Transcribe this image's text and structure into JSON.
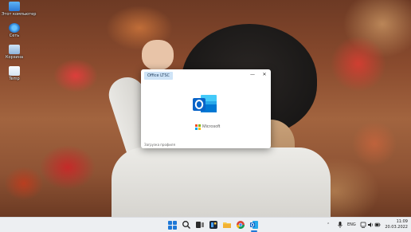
{
  "desktop": {
    "icons": [
      {
        "label": "Этот компьютер",
        "icon": "computer-icon"
      },
      {
        "label": "Сеть",
        "icon": "network-icon"
      },
      {
        "label": "Корзина",
        "icon": "recycle-bin-icon"
      },
      {
        "label": "Temp",
        "icon": "folder-icon"
      }
    ]
  },
  "splash": {
    "badge": "Office LTSC",
    "minimize_glyph": "—",
    "close_glyph": "✕",
    "app_icon": "outlook-icon",
    "brand": "Microsoft",
    "status": "Загрузка профиля"
  },
  "taskbar": {
    "apps": [
      "start-icon",
      "search-icon",
      "task-view-icon",
      "widgets-icon",
      "file-explorer-icon",
      "chrome-icon",
      "outlook-icon"
    ],
    "tray": {
      "chevron": "⌃",
      "language": "ENG"
    },
    "clock": {
      "time": "11:09",
      "date": "20.03.2022"
    }
  },
  "colors": {
    "accent": "#1e78d7",
    "outlook_blue": "#0a64c8",
    "ms_red": "#f25022",
    "ms_green": "#7fba00",
    "ms_blue": "#00a4ef",
    "ms_yellow": "#ffb900"
  }
}
